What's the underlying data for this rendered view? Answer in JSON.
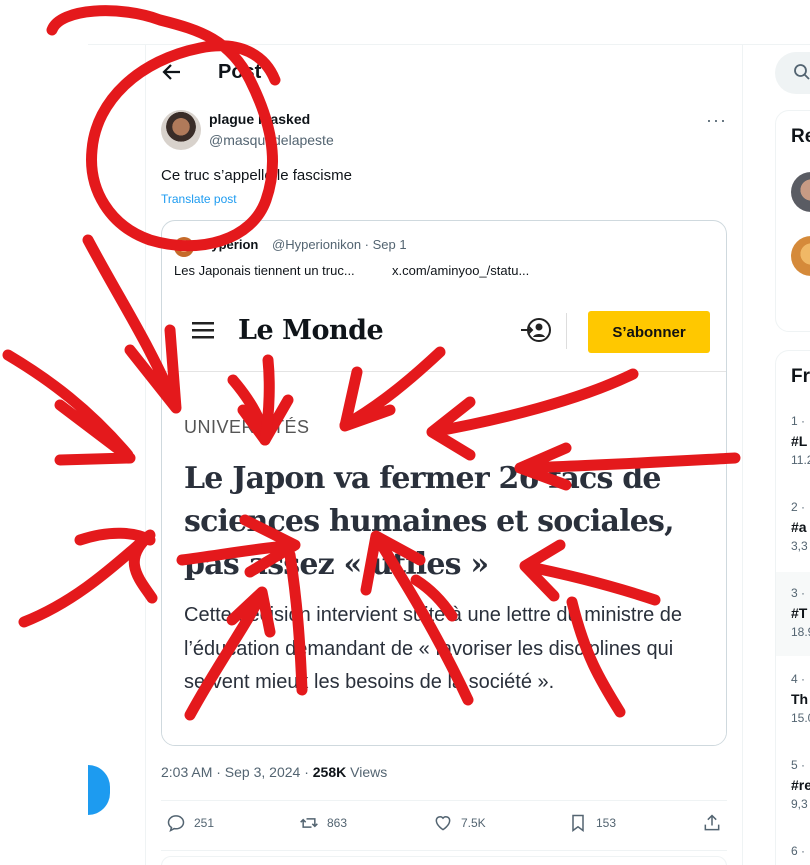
{
  "header": {
    "title": "Post"
  },
  "post": {
    "display_name": "plague masked",
    "handle": "@masquedelapeste",
    "text": "Ce truc s’appelle le fascisme",
    "translate_label": "Translate post",
    "timestamp": "2:03 AM · Sep 3, 2024 ·",
    "views_count": "258K",
    "views_label": "Views"
  },
  "quote": {
    "name": "Hyperion",
    "handle_date": "@Hyperionikon · Sep 1",
    "text": "Les Japonais tiennent un truc...",
    "link": "x.com/aminyoo_/statu..."
  },
  "lemonde": {
    "logo": "Le Monde",
    "subscribe": "S’abonner",
    "section": "UNIVERSITÉS",
    "headline": "Le Japon va fermer 26 facs de sciences humaines et sociales, pas assez « utiles »",
    "lede": "Cette décision intervient suite à une lettre du ministre de l’éducation demandant de « favoriser les disciplines qui servent mieux les besoins de la société »."
  },
  "actions": {
    "replies": "251",
    "reposts": "863",
    "likes": "7.5K",
    "bookmarks": "153"
  },
  "sidebar_right": {
    "relevant_title": "Re",
    "trends_title": "Fr",
    "trends": [
      {
        "rank": "1 ·",
        "name": "#L",
        "count": "11.2"
      },
      {
        "rank": "2 ·",
        "name": "#a",
        "count": "3,3"
      },
      {
        "rank": "3 ·",
        "name": "#T",
        "count": "18.9"
      },
      {
        "rank": "4 ·",
        "name": "Th",
        "count": "15.0"
      },
      {
        "rank": "5 ·",
        "name": "#re",
        "count": "9,3"
      },
      {
        "rank": "6 ·",
        "name": "",
        "count": ""
      }
    ]
  },
  "colors": {
    "accent": "#1d9bf0",
    "annotation": "#e4191c",
    "subscribe_bg": "#ffc800"
  }
}
